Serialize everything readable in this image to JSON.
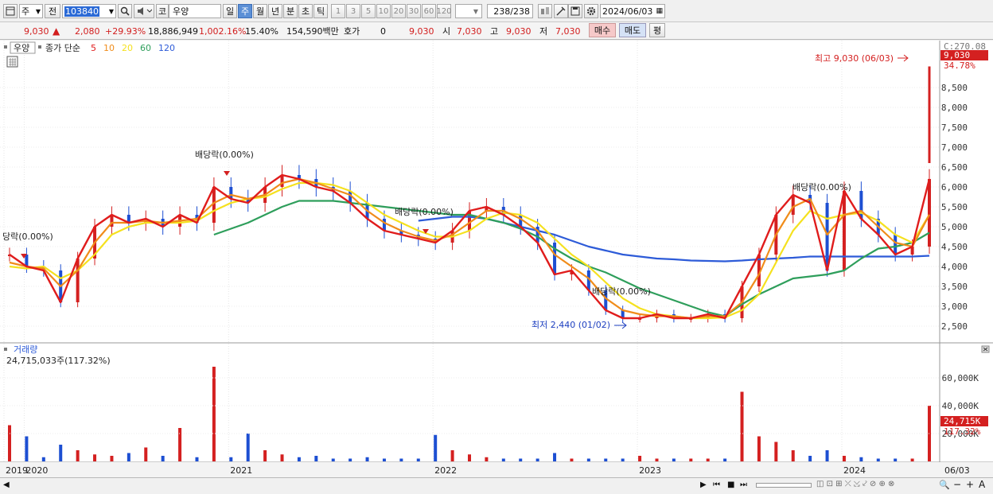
{
  "toolbar": {
    "type_select": "주",
    "prev_label": "전",
    "code_value": "103840",
    "market_label": "코",
    "stock_name": "우양",
    "periods": [
      "일",
      "주",
      "월",
      "년",
      "분",
      "초",
      "틱"
    ],
    "active_period": "주",
    "intervals": [
      "1",
      "3",
      "5",
      "10",
      "20",
      "30",
      "60",
      "120"
    ],
    "count": "238",
    "count_total": "/238",
    "date": "2024/06/03"
  },
  "quote": {
    "price": "9,030",
    "change": "2,080",
    "change_pct": "+29.93%",
    "volume": "18,886,949",
    "volume_ratio": "1,002.16%",
    "turnover": "15.40%",
    "amount": "154,590백만",
    "hoga_label": "호가",
    "hoga_value": "0",
    "current": "9,030",
    "open_label": "시",
    "open": "7,030",
    "high_label": "고",
    "high": "9,030",
    "low_label": "저",
    "low": "7,030",
    "buy_label": "매수",
    "sell_label": "매도",
    "avg_label": "평"
  },
  "legend": {
    "stock": "우양",
    "title": "종가 단순",
    "ma": [
      {
        "period": "5",
        "color": "#e01c1c"
      },
      {
        "period": "10",
        "color": "#f08c1a"
      },
      {
        "period": "20",
        "color": "#f5e11e"
      },
      {
        "period": "60",
        "color": "#2e9e5b"
      },
      {
        "period": "120",
        "color": "#2d5bd8"
      }
    ]
  },
  "price_axis": {
    "top_label": "C:270.08",
    "current_tag": "9,030",
    "pct_tag": "34.78%"
  },
  "annotations": {
    "high": "최고 9,030 (06/03)",
    "low": "최저 2,440 (01/02)",
    "dividend": "배당락(0.00%)",
    "dividend_edge": "당락(0.00%)"
  },
  "volume_panel": {
    "title": "거래량",
    "value": "24,715,033주(117.32%)",
    "current_tag": "24,715K",
    "pct_tag": "117.32%"
  },
  "x_axis": {
    "years": [
      "2019",
      "2020",
      "2021",
      "2022",
      "2023",
      "2024"
    ],
    "last_date": "06/03"
  },
  "chart_data": [
    {
      "type": "line",
      "title": "우양",
      "ylim": [
        2200,
        9300
      ],
      "y_ticks": [
        2500,
        3000,
        3500,
        4000,
        4500,
        5000,
        5500,
        6000,
        6500,
        7000,
        7500,
        8000,
        8500
      ],
      "x": [
        "2019-12",
        "2020-01",
        "2020-02",
        "2020-03",
        "2020-04",
        "2020-05",
        "2020-06",
        "2020-07",
        "2020-08",
        "2020-09",
        "2020-10",
        "2020-11",
        "2020-12",
        "2021-01",
        "2021-02",
        "2021-03",
        "2021-04",
        "2021-05",
        "2021-06",
        "2021-07",
        "2021-08",
        "2021-09",
        "2021-10",
        "2021-11",
        "2021-12",
        "2022-01",
        "2022-02",
        "2022-03",
        "2022-04",
        "2022-05",
        "2022-06",
        "2022-07",
        "2022-08",
        "2022-09",
        "2022-10",
        "2022-11",
        "2022-12",
        "2023-01",
        "2023-02",
        "2023-03",
        "2023-04",
        "2023-05",
        "2023-06",
        "2023-07",
        "2023-08",
        "2023-09",
        "2023-10",
        "2023-11",
        "2023-12",
        "2024-01",
        "2024-02",
        "2024-03",
        "2024-04",
        "2024-05",
        "2024-06"
      ],
      "series": [
        {
          "name": "5",
          "values": [
            4300,
            4000,
            3900,
            3100,
            4200,
            5000,
            5300,
            5100,
            5200,
            5000,
            5300,
            5100,
            6000,
            5700,
            5600,
            6000,
            6300,
            6200,
            6000,
            5900,
            5600,
            5200,
            4900,
            4800,
            4700,
            4600,
            4900,
            5400,
            5500,
            5300,
            5000,
            4600,
            3800,
            3900,
            3400,
            2900,
            2700,
            2700,
            2800,
            2700,
            2700,
            2800,
            2700,
            3500,
            4300,
            5300,
            5800,
            5600,
            3900,
            5900,
            5200,
            4800,
            4300,
            4500,
            6200
          ]
        },
        {
          "name": "10",
          "values": [
            4100,
            4000,
            3950,
            3500,
            3900,
            4600,
            5100,
            5100,
            5150,
            5100,
            5150,
            5200,
            5600,
            5800,
            5700,
            5800,
            6100,
            6200,
            6100,
            5950,
            5800,
            5400,
            5100,
            4900,
            4750,
            4650,
            4800,
            5100,
            5400,
            5400,
            5200,
            4900,
            4300,
            4000,
            3700,
            3200,
            2900,
            2800,
            2750,
            2750,
            2700,
            2750,
            2750,
            3100,
            3800,
            4800,
            5500,
            5700,
            4800,
            5300,
            5400,
            5000,
            4600,
            4500,
            5300
          ]
        },
        {
          "name": "20",
          "values": [
            4000,
            3950,
            4000,
            3700,
            3900,
            4300,
            4800,
            5000,
            5100,
            5100,
            5100,
            5150,
            5400,
            5600,
            5700,
            5750,
            5950,
            6100,
            6100,
            6050,
            5900,
            5600,
            5300,
            5100,
            4900,
            4750,
            4750,
            4900,
            5200,
            5350,
            5300,
            5100,
            4700,
            4300,
            4000,
            3600,
            3200,
            2950,
            2800,
            2750,
            2700,
            2700,
            2720,
            2900,
            3300,
            4100,
            4900,
            5400,
            5200,
            5300,
            5350,
            5150,
            4800,
            4600,
            5300
          ]
        },
        {
          "name": "60",
          "values": [
            null,
            null,
            null,
            null,
            null,
            null,
            null,
            null,
            null,
            null,
            null,
            null,
            4800,
            4950,
            5100,
            5300,
            5500,
            5650,
            5650,
            5650,
            5600,
            5550,
            5500,
            5450,
            5400,
            5350,
            5300,
            5300,
            5200,
            5100,
            4950,
            4750,
            4450,
            4200,
            4000,
            3850,
            3650,
            3450,
            3300,
            3150,
            3000,
            2850,
            2750,
            3050,
            3300,
            3500,
            3700,
            3750,
            3800,
            3900,
            4200,
            4450,
            4500,
            4600,
            4850
          ]
        },
        {
          "name": "120",
          "values": [
            null,
            null,
            null,
            null,
            null,
            null,
            null,
            null,
            null,
            null,
            null,
            null,
            null,
            null,
            null,
            null,
            null,
            null,
            null,
            null,
            null,
            null,
            null,
            null,
            5150,
            5200,
            5250,
            5250,
            5200,
            5100,
            5000,
            4900,
            4800,
            4650,
            4500,
            4400,
            4300,
            4250,
            4200,
            4180,
            4150,
            4140,
            4130,
            4150,
            4180,
            4200,
            4220,
            4250,
            4250,
            4250,
            4250,
            4250,
            4250,
            4250,
            4270
          ]
        }
      ]
    },
    {
      "type": "bar",
      "title": "거래량",
      "ylabel": "",
      "ylim": [
        0,
        80000
      ],
      "y_ticks": [
        20000,
        40000,
        60000
      ],
      "y_tick_labels": [
        "20,000K",
        "40,000K",
        "60,000K"
      ],
      "x": [
        "2019-12",
        "2020-01",
        "2020-02",
        "2020-03",
        "2020-04",
        "2020-05",
        "2020-06",
        "2020-07",
        "2020-08",
        "2020-09",
        "2020-10",
        "2020-11",
        "2020-12",
        "2021-01",
        "2021-02",
        "2021-03",
        "2021-04",
        "2021-05",
        "2021-06",
        "2021-07",
        "2021-08",
        "2021-09",
        "2021-10",
        "2021-11",
        "2021-12",
        "2022-01",
        "2022-02",
        "2022-03",
        "2022-04",
        "2022-05",
        "2022-06",
        "2022-07",
        "2022-08",
        "2022-09",
        "2022-10",
        "2022-11",
        "2022-12",
        "2023-01",
        "2023-02",
        "2023-03",
        "2023-04",
        "2023-05",
        "2023-06",
        "2023-07",
        "2023-08",
        "2023-09",
        "2023-10",
        "2023-11",
        "2023-12",
        "2024-01",
        "2024-02",
        "2024-03",
        "2024-04",
        "2024-05",
        "2024-06"
      ],
      "values": [
        26000,
        18000,
        3000,
        12000,
        8000,
        5000,
        4000,
        6000,
        10000,
        4000,
        24000,
        3000,
        68000,
        3000,
        20000,
        8000,
        5000,
        3000,
        4000,
        2000,
        2000,
        3000,
        2000,
        2000,
        2000,
        19000,
        8000,
        5000,
        3000,
        2000,
        2000,
        2000,
        6000,
        2000,
        2000,
        2000,
        2000,
        4000,
        2000,
        2000,
        2000,
        2000,
        2000,
        50000,
        18000,
        14000,
        8000,
        4000,
        8000,
        4000,
        3000,
        2000,
        2000,
        2000,
        40000
      ]
    }
  ]
}
